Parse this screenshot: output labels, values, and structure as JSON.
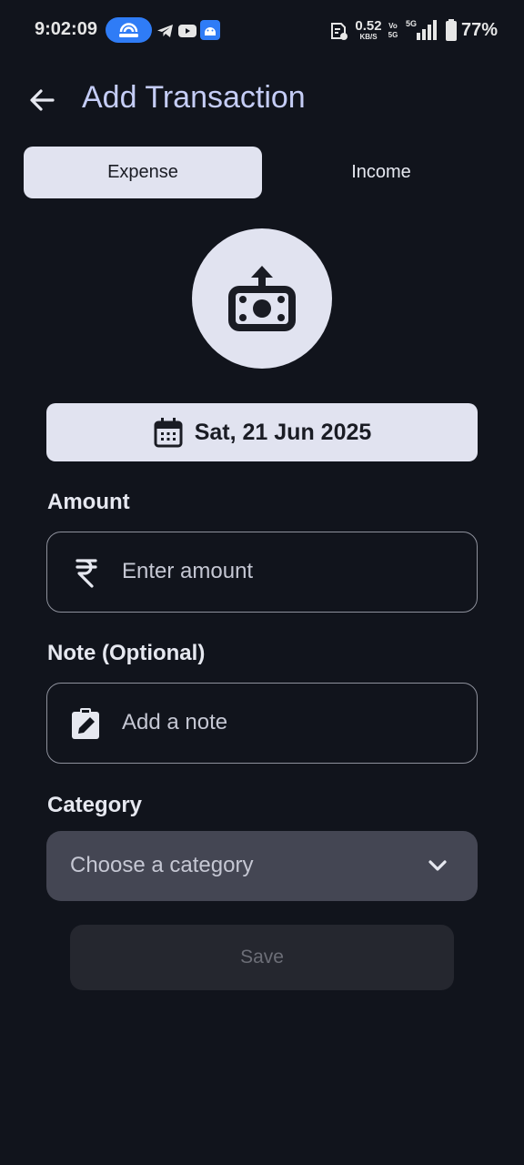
{
  "status_bar": {
    "time": "9:02:09",
    "net_speed_value": "0.52",
    "net_speed_unit": "KB/S",
    "volte_top": "Vo",
    "volte_bottom": "5G",
    "signal_label": "5G",
    "battery": "77%",
    "icons": [
      "hotspot-icon",
      "telegram-icon",
      "youtube-icon",
      "android-icon",
      "sim-card-icon",
      "signal-icon",
      "battery-icon"
    ]
  },
  "header": {
    "title": "Add Transaction",
    "back_icon": "arrow-left-icon"
  },
  "tabs": [
    {
      "label": "Expense",
      "selected": true
    },
    {
      "label": "Income",
      "selected": false
    }
  ],
  "type_icon": "expense-money-icon",
  "date": {
    "label": "Sat, 21 Jun 2025",
    "icon": "calendar-icon"
  },
  "amount": {
    "label": "Amount",
    "placeholder": "Enter amount",
    "value": "",
    "icon": "rupee-icon"
  },
  "note": {
    "label": "Note (Optional)",
    "placeholder": "Add a note",
    "value": "",
    "icon": "edit-note-icon"
  },
  "category": {
    "label": "Category",
    "placeholder": "Choose a category",
    "icon": "chevron-down-icon"
  },
  "save": {
    "label": "Save",
    "enabled": false
  },
  "colors": {
    "background": "#11141c",
    "title": "#c5cdf6",
    "surface_light": "#e1e3f0",
    "outline": "#8e919c",
    "select_bg": "#444653",
    "disabled_button": "#25272f",
    "hotspot": "#2f7cf6"
  }
}
